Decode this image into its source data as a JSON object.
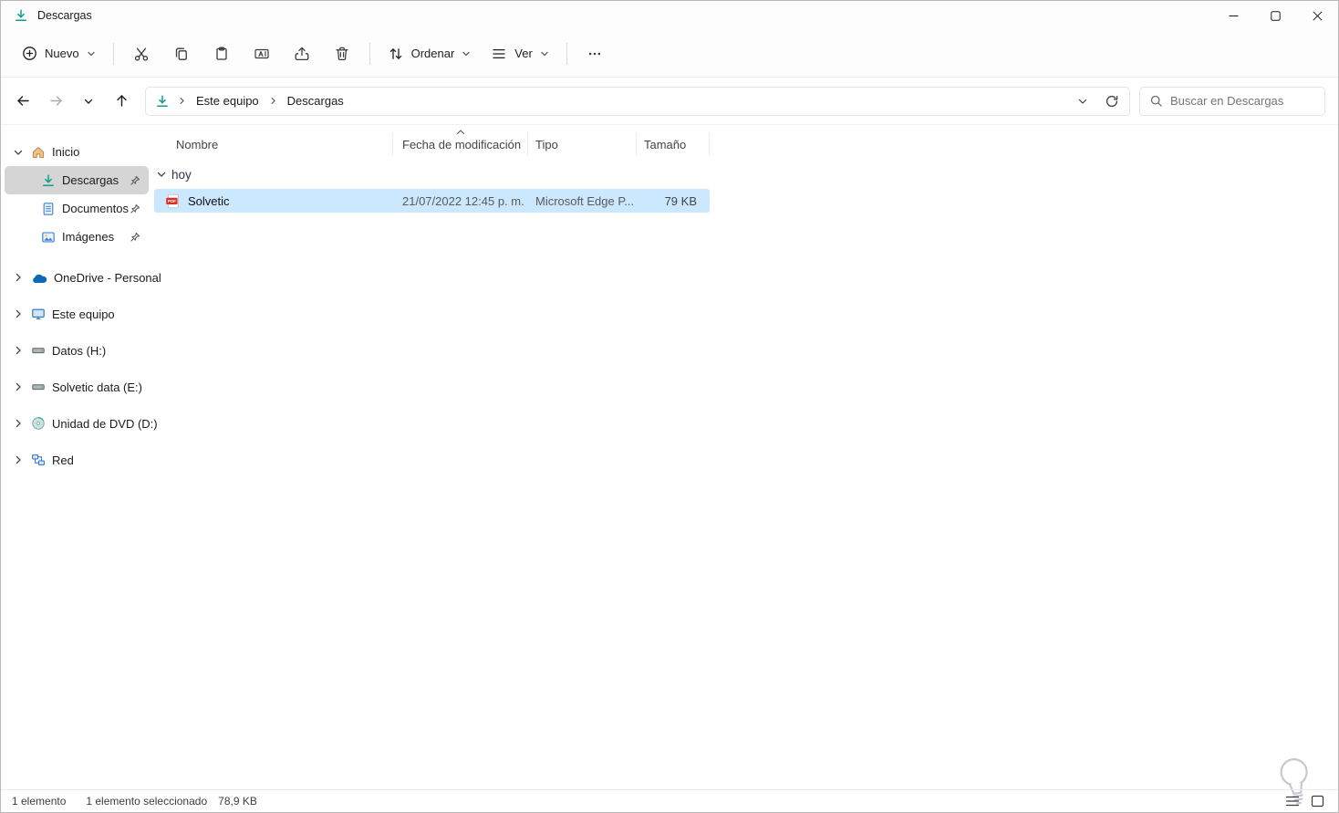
{
  "colors": {
    "chrome-bg": "#fdfdfd",
    "selection": "#cce8ff",
    "sidebar-selected": "#d5d5d5",
    "download-green": "#0f9d8f",
    "pdf-red": "#d93025",
    "accent": "#0067c0"
  },
  "window": {
    "title": "Descargas"
  },
  "toolbar": {
    "new_label": "Nuevo",
    "sort_label": "Ordenar",
    "view_label": "Ver"
  },
  "navbar": {
    "breadcrumb": [
      "Este equipo",
      "Descargas"
    ],
    "search_placeholder": "Buscar en Descargas"
  },
  "sidebar": {
    "items": [
      {
        "label": "Inicio"
      },
      {
        "label": "Descargas"
      },
      {
        "label": "Documentos"
      },
      {
        "label": "Imágenes"
      },
      {
        "label": "OneDrive - Personal"
      },
      {
        "label": "Este equipo"
      },
      {
        "label": "Datos (H:)"
      },
      {
        "label": "Solvetic data (E:)"
      },
      {
        "label": "Unidad de DVD (D:)"
      },
      {
        "label": "Red"
      }
    ]
  },
  "main": {
    "columns": [
      "Nombre",
      "Fecha de modificación",
      "Tipo",
      "Tamaño"
    ],
    "group_label": "hoy",
    "files": [
      {
        "name": "Solvetic",
        "modified": "21/07/2022 12:45 p. m.",
        "type": "Microsoft Edge P...",
        "size": "79 KB"
      }
    ]
  },
  "statusbar": {
    "items_count": "1 elemento",
    "selection_count": "1 elemento seleccionado",
    "selection_size": "78,9 KB"
  }
}
